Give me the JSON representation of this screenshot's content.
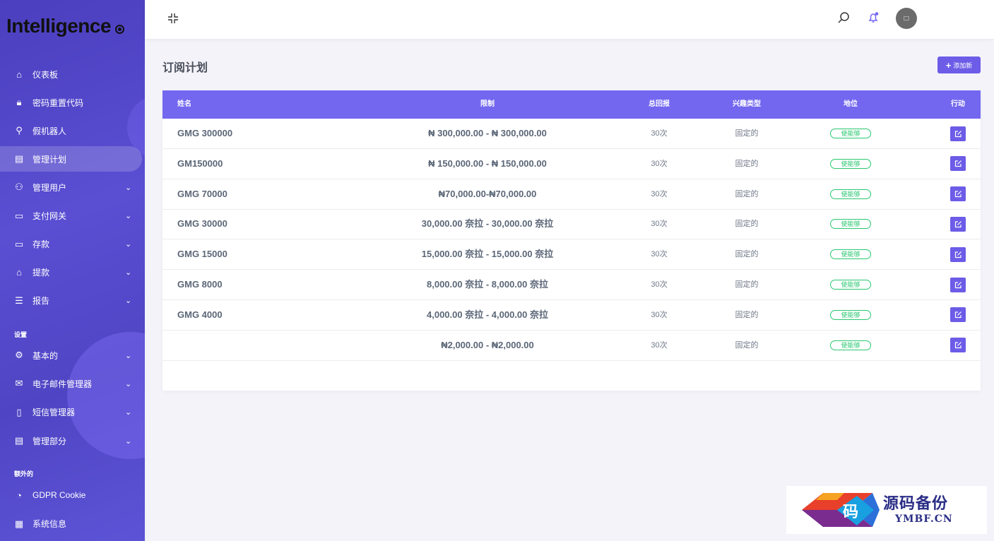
{
  "brand": {
    "apple": "",
    "name": "Intelligence"
  },
  "sidebar": {
    "items": [
      {
        "label": "仪表板",
        "icon": "home-icon",
        "chevron": false
      },
      {
        "label": "密码重置代码",
        "icon": "lock-icon",
        "chevron": false
      },
      {
        "label": "假机器人",
        "icon": "link-icon",
        "chevron": false
      },
      {
        "label": "管理计划",
        "icon": "plan-icon",
        "chevron": false,
        "active": true
      },
      {
        "label": "管理用户",
        "icon": "users-icon",
        "chevron": true
      },
      {
        "label": "支付网关",
        "icon": "card-icon",
        "chevron": true
      },
      {
        "label": "存款",
        "icon": "wallet-icon",
        "chevron": true
      },
      {
        "label": "提款",
        "icon": "bank-icon",
        "chevron": true
      },
      {
        "label": "报告",
        "icon": "list-icon",
        "chevron": true
      }
    ],
    "section_settings": "设置",
    "settings_items": [
      {
        "label": "基本的",
        "icon": "gear-icon",
        "chevron": true
      },
      {
        "label": "电子邮件管理器",
        "icon": "mail-icon",
        "chevron": true
      },
      {
        "label": "短信管理器",
        "icon": "phone-icon",
        "chevron": true
      },
      {
        "label": "管理部分",
        "icon": "section-icon",
        "chevron": true
      }
    ],
    "section_extra": "额外的",
    "extra_items": [
      {
        "label": "GDPR Cookie",
        "icon": "cookie-icon",
        "chevron": false
      },
      {
        "label": "系统信息",
        "icon": "server-icon",
        "chevron": false
      }
    ]
  },
  "header": {
    "page_title": "订阅计划",
    "add_label": "添加新",
    "add_plus": "+"
  },
  "table": {
    "columns": [
      "姓名",
      "限制",
      "总回报",
      "兴趣类型",
      "地位",
      "行动"
    ],
    "rows": [
      {
        "name": "GMG 300000",
        "limit": "₦ 300,000.00 - ₦ 300,000.00",
        "return": "30次",
        "type": "固定的",
        "status": "使能够"
      },
      {
        "name": "GM150000",
        "limit": "₦ 150,000.00 - ₦ 150,000.00",
        "return": "30次",
        "type": "固定的",
        "status": "使能够"
      },
      {
        "name": "GMG 70000",
        "limit": "₦70,000.00-₦70,000.00",
        "return": "30次",
        "type": "固定的",
        "status": "使能够"
      },
      {
        "name": "GMG 30000",
        "limit": "30,000.00 奈拉 - 30,000.00 奈拉",
        "return": "30次",
        "type": "固定的",
        "status": "使能够"
      },
      {
        "name": "GMG 15000",
        "limit": "15,000.00 奈拉 - 15,000.00 奈拉",
        "return": "30次",
        "type": "固定的",
        "status": "使能够"
      },
      {
        "name": "GMG 8000",
        "limit": "8,000.00 奈拉 - 8,000.00 奈拉",
        "return": "30次",
        "type": "固定的",
        "status": "使能够"
      },
      {
        "name": "GMG 4000",
        "limit": "4,000.00 奈拉 - 4,000.00 奈拉",
        "return": "30次",
        "type": "固定的",
        "status": "使能够"
      },
      {
        "name": "",
        "limit": "₦2,000.00 - ₦2,000.00",
        "return": "30次",
        "type": "固定的",
        "status": "使能够"
      }
    ]
  },
  "watermark": {
    "text_cn": "源码备份",
    "text_en": "YMBF.CN",
    "logo_char": "码"
  },
  "colors": {
    "accent": "#7367f0",
    "button": "#6c5ce7",
    "success": "#28c76f",
    "sidebar": "#5046c8"
  }
}
